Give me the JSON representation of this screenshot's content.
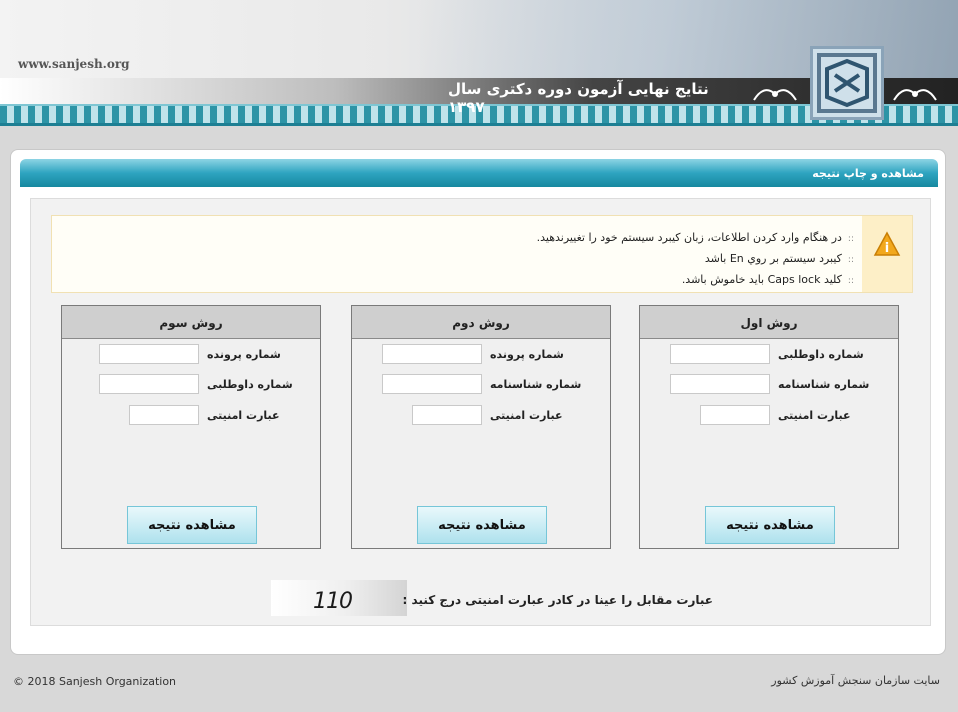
{
  "header": {
    "site_url": "www.sanjesh.org",
    "title": "نتایج نهایی آزمون دوره دکتری سال ۱۳۹۷"
  },
  "panel": {
    "title": "مشاهده و چاپ نتیجه"
  },
  "notice": {
    "items": [
      "در هنگام وارد کردن اطلاعات، زبان کیبرد سیستم خود را تغییرندهید.",
      "کیبرد سیستم بر روي En باشد",
      "کلید Caps lock باید خاموش باشد."
    ]
  },
  "methods": [
    {
      "title": "روش اول",
      "fields": [
        {
          "label": "شماره داوطلبی",
          "value": ""
        },
        {
          "label": "شماره شناسنامه",
          "value": ""
        },
        {
          "label": "عبارت امنیتی",
          "value": ""
        }
      ],
      "button": "مشاهده نتیجه"
    },
    {
      "title": "روش دوم",
      "fields": [
        {
          "label": "شماره پرونده",
          "value": ""
        },
        {
          "label": "شماره شناسنامه",
          "value": ""
        },
        {
          "label": "عبارت امنیتی",
          "value": ""
        }
      ],
      "button": "مشاهده نتیجه"
    },
    {
      "title": "روش سوم",
      "fields": [
        {
          "label": "شماره پرونده",
          "value": ""
        },
        {
          "label": "شماره داوطلبی",
          "value": ""
        },
        {
          "label": "عبارت امنیتی",
          "value": ""
        }
      ],
      "button": "مشاهده نتیجه"
    }
  ],
  "captcha": {
    "instruction": "عبارت مقابل را عینا در کادر عبارت امنیتی درج کنید :",
    "code": "110"
  },
  "footer": {
    "copyright": "© 2018 Sanjesh Organization",
    "site_name": "سایت سازمان سنجش آموزش کشور"
  },
  "colors": {
    "title_bar": "#2ea4c0",
    "button": "#c9ecf4",
    "notice_bg": "#fffef7",
    "warning_icon": "#f2a81d"
  },
  "icons": {
    "notice": "warning-icon",
    "logo": "sanjesh-logo"
  }
}
